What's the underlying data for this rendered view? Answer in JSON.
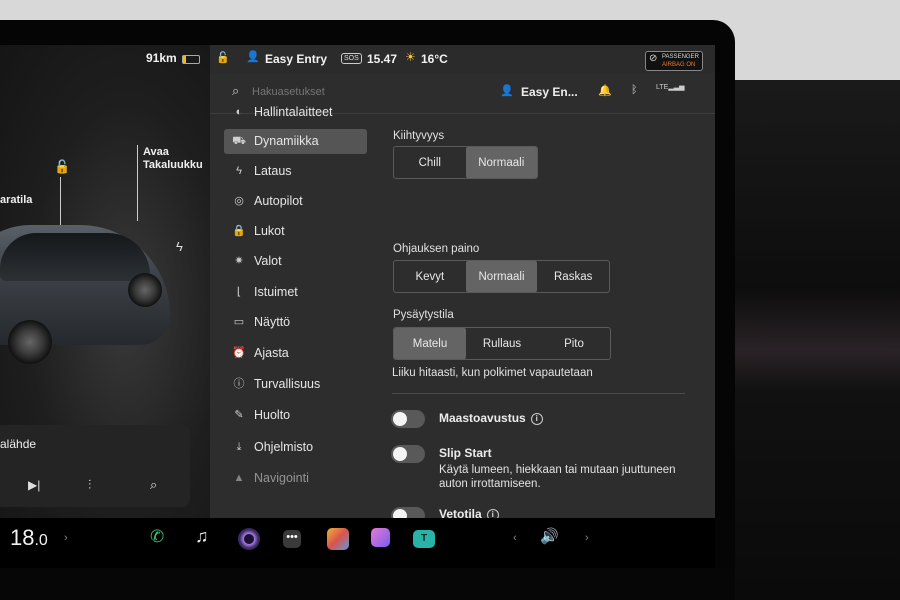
{
  "status": {
    "range": "91km",
    "profile": "Easy Entry",
    "sos": "SOS",
    "time": "15.47",
    "temperature": "16°C",
    "airbag_line1": "PASSENGER",
    "airbag_line2": "AIRBAG ON"
  },
  "car": {
    "trunk_label_1": "Avaa",
    "trunk_label_2": "Takaluukku",
    "frunk_label": "aratila",
    "media_source": "alähde"
  },
  "search": {
    "placeholder": "Hakuasetukset",
    "profile": "Easy En..."
  },
  "nav": [
    {
      "label": "Hallintalaitteet",
      "icon": "toggle-icon"
    },
    {
      "label": "Dynamiikka",
      "icon": "car-icon"
    },
    {
      "label": "Lataus",
      "icon": "bolt-icon"
    },
    {
      "label": "Autopilot",
      "icon": "steering-wheel-icon"
    },
    {
      "label": "Lukot",
      "icon": "lock-icon"
    },
    {
      "label": "Valot",
      "icon": "light-icon"
    },
    {
      "label": "Istuimet",
      "icon": "seat-icon"
    },
    {
      "label": "Näyttö",
      "icon": "display-icon"
    },
    {
      "label": "Ajasta",
      "icon": "alarm-icon"
    },
    {
      "label": "Turvallisuus",
      "icon": "shield-icon"
    },
    {
      "label": "Huolto",
      "icon": "wrench-icon"
    },
    {
      "label": "Ohjelmisto",
      "icon": "download-icon"
    },
    {
      "label": "Navigointi",
      "icon": "navigation-icon"
    }
  ],
  "dynamics": {
    "acceleration": {
      "title": "Kiihtyvyys",
      "options": [
        "Chill",
        "Normaali"
      ],
      "selected": "Normaali"
    },
    "steering": {
      "title": "Ohjauksen paino",
      "options": [
        "Kevyt",
        "Normaali",
        "Raskas"
      ],
      "selected": "Normaali"
    },
    "stopping": {
      "title": "Pysäytystila",
      "options": [
        "Matelu",
        "Rullaus",
        "Pito"
      ],
      "selected": "Matelu",
      "description": "Liiku hitaasti, kun polkimet vapautetaan"
    },
    "toggles": [
      {
        "label": "Maastoavustus",
        "on": false
      },
      {
        "label": "Slip Start",
        "on": false,
        "description_1": "Käytä lumeen, hiekkaan tai mutaan juuttuneen",
        "description_2": "auton irrottamiseen."
      },
      {
        "label": "Vetotila",
        "on": false
      }
    ]
  },
  "taskbar": {
    "temp_whole": "18",
    "temp_decimal": ".0",
    "apps": [
      "phone-icon",
      "music-icon",
      "camera-icon",
      "more-icon",
      "photos-icon",
      "notes-icon",
      "toybox-icon"
    ],
    "volume_icon": "volume-icon"
  },
  "colors": {
    "screen_bg": "#2d2d2d",
    "selected_segment": "#646464",
    "active_nav": "#555555",
    "phone_green": "#3ec36a"
  }
}
